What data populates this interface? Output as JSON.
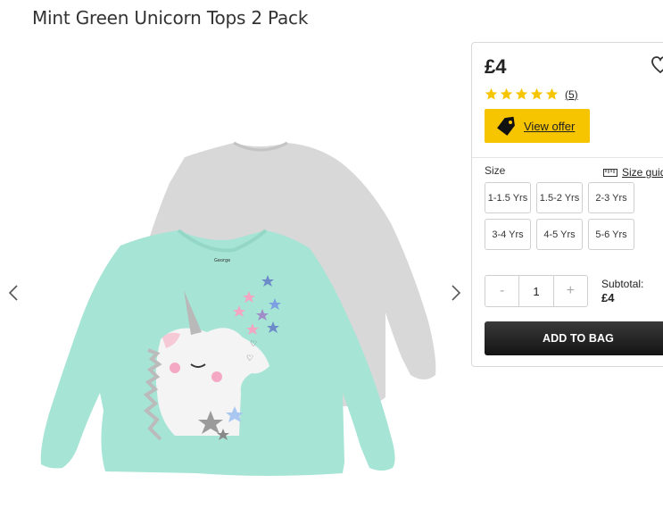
{
  "product": {
    "title": "Mint Green Unicorn Tops 2 Pack",
    "price": "£4",
    "rating_stars": 5,
    "rating_count": "(5)",
    "offer_label": "View offer",
    "size_label": "Size",
    "size_guide_label": "Size guide",
    "sizes": [
      "1-1.5 Yrs",
      "1.5-2 Yrs",
      "2-3 Yrs",
      "3-4 Yrs",
      "4-5 Yrs",
      "5-6 Yrs"
    ],
    "quantity": "1",
    "minus_label": "-",
    "plus_label": "+",
    "subtotal_label": "Subtotal:",
    "subtotal_value": "£4",
    "add_to_bag_label": "ADD TO BAG",
    "garment_brand": "George"
  },
  "colors": {
    "offer_yellow": "#f7c400",
    "star_yellow": "#f7c400",
    "mint_top": "#a6e4d5",
    "grey_top": "#d6d6d6",
    "button_dark": "#1f1f1f"
  },
  "icons": {
    "heart": "heart-outline-icon",
    "tag": "price-tag-icon",
    "ruler": "ruler-icon",
    "prev": "chevron-left-icon",
    "next": "chevron-right-icon"
  }
}
